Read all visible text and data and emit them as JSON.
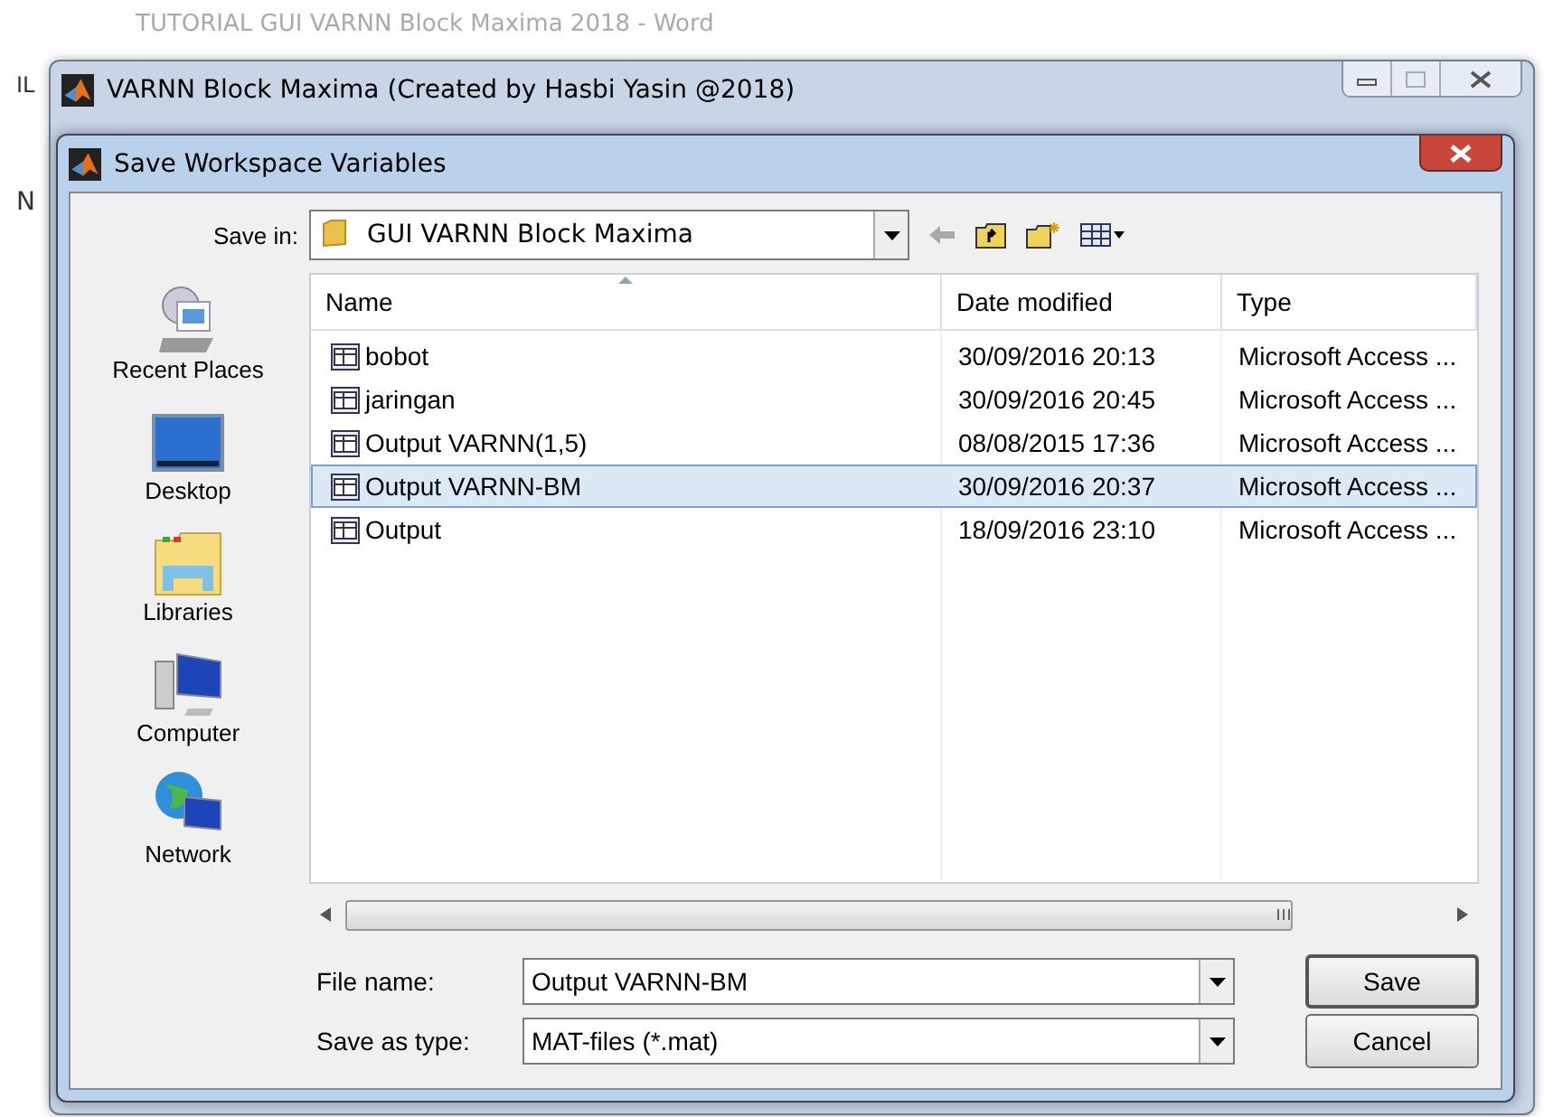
{
  "background_window": {
    "title": "TUTORIAL GUI VARNN Block Maxima 2018 - Word",
    "fragments": [
      "IL",
      "N"
    ]
  },
  "app_window": {
    "title": "VARNN Block Maxima (Created by Hasbi Yasin @2018)"
  },
  "dialog": {
    "title": "Save Workspace Variables",
    "save_in": {
      "label": "Save in:",
      "value": "GUI VARNN Block Maxima"
    },
    "places": [
      {
        "label": "Recent Places",
        "kind": "recent"
      },
      {
        "label": "Desktop",
        "kind": "desktop"
      },
      {
        "label": "Libraries",
        "kind": "libraries"
      },
      {
        "label": "Computer",
        "kind": "computer"
      },
      {
        "label": "Network",
        "kind": "network"
      }
    ],
    "columns": [
      "Name",
      "Date modified",
      "Type"
    ],
    "files": [
      {
        "name": "bobot",
        "date": "30/09/2016 20:13",
        "type": "Microsoft Access ...",
        "selected": false
      },
      {
        "name": "jaringan",
        "date": "30/09/2016 20:45",
        "type": "Microsoft Access ...",
        "selected": false
      },
      {
        "name": "Output VARNN(1,5)",
        "date": "08/08/2015 17:36",
        "type": "Microsoft Access ...",
        "selected": false
      },
      {
        "name": "Output VARNN-BM",
        "date": "30/09/2016 20:37",
        "type": "Microsoft Access ...",
        "selected": true
      },
      {
        "name": "Output",
        "date": "18/09/2016 23:10",
        "type": "Microsoft Access ...",
        "selected": false
      }
    ],
    "file_name": {
      "label": "File name:",
      "value": "Output VARNN-BM"
    },
    "save_as_type": {
      "label": "Save as type:",
      "value": "MAT-files (*.mat)"
    },
    "buttons": [
      "Save",
      "Cancel"
    ]
  }
}
